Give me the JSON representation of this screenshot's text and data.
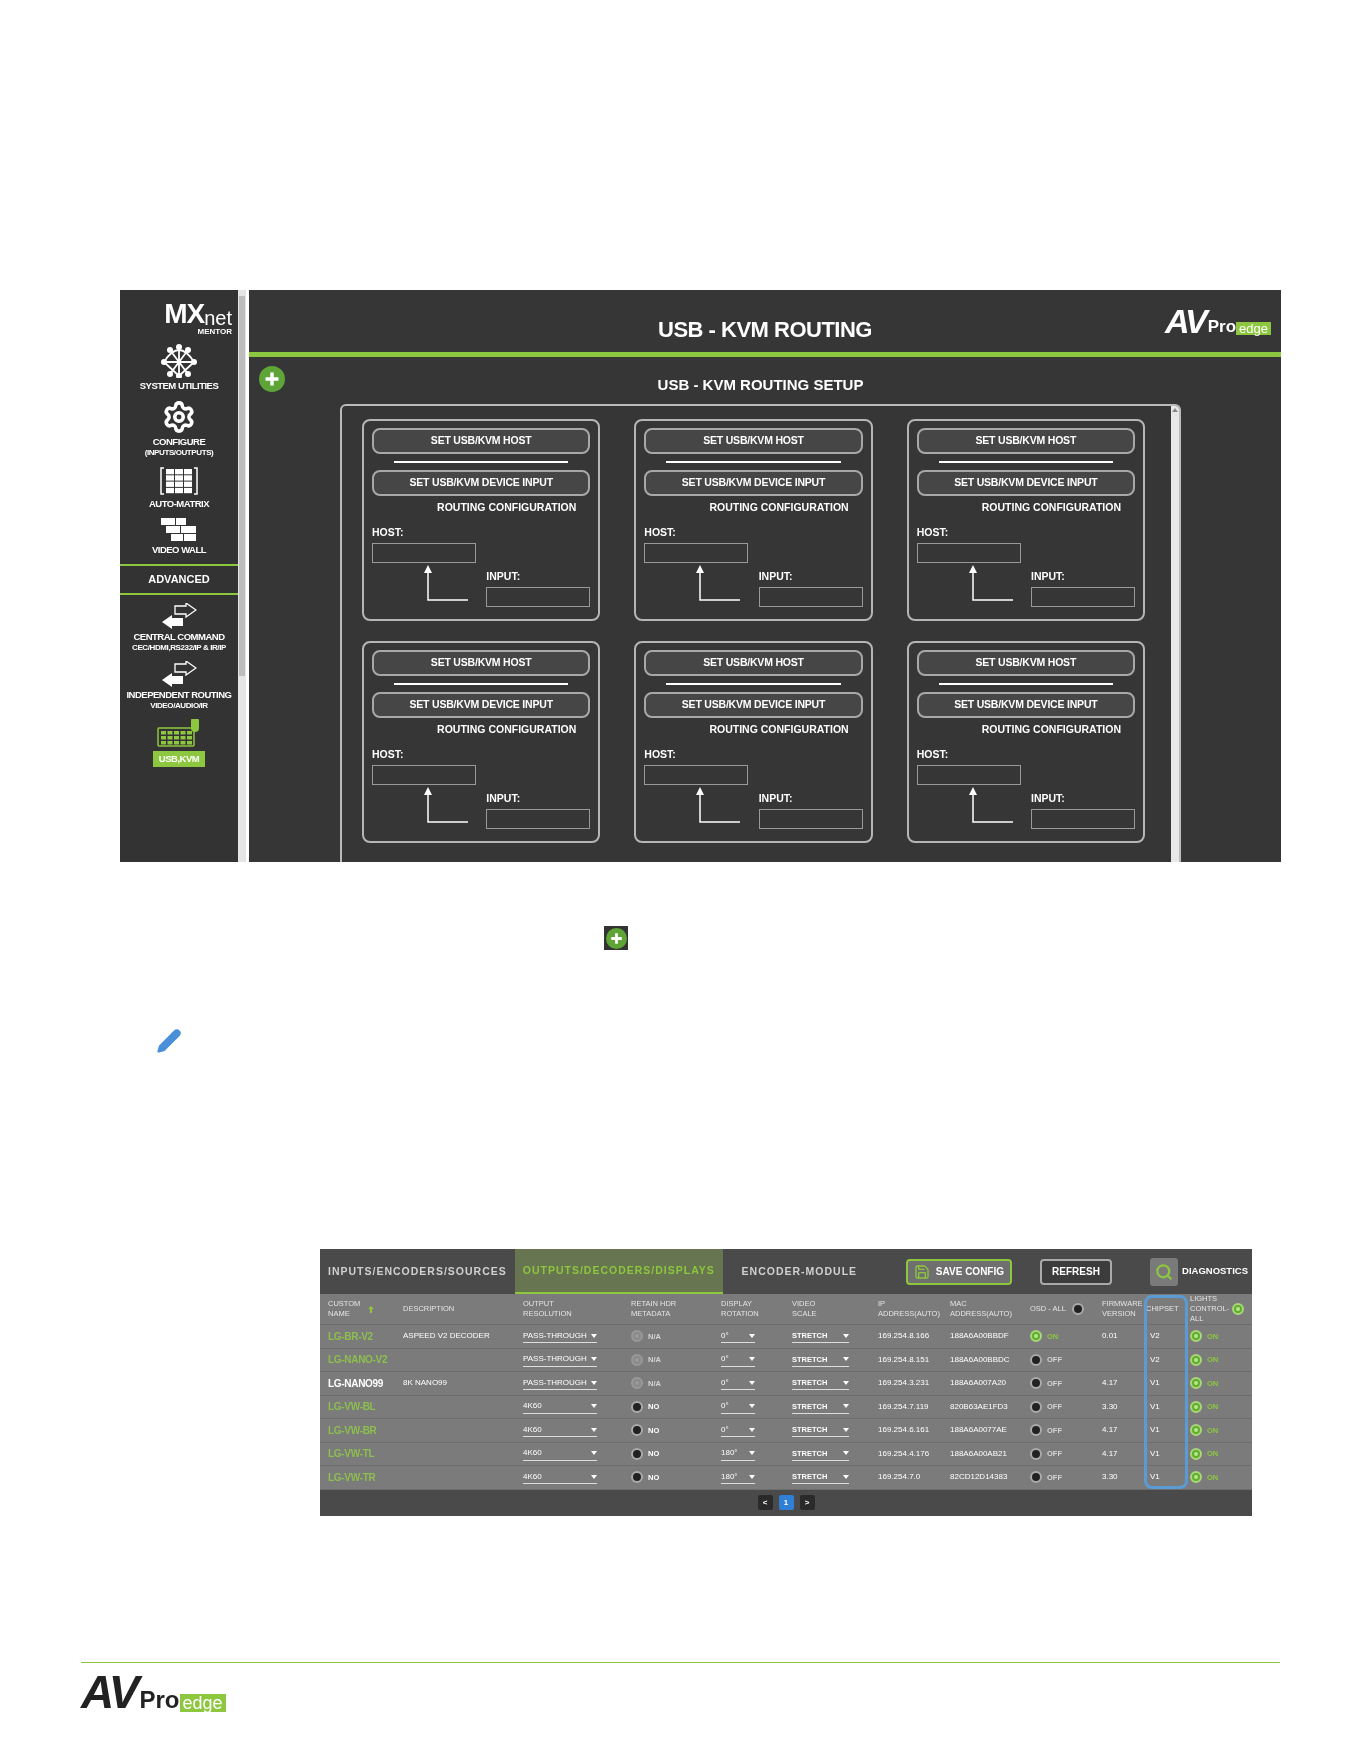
{
  "kvm_screen": {
    "sidebar": {
      "logo": {
        "main": "MX",
        "suffix": "net",
        "tagline": "MENTOR"
      },
      "items": [
        {
          "label": "SYSTEM UTILITIES",
          "selected": false
        },
        {
          "label": "CONFIGURE",
          "sublabel": "(INPUTS/OUTPUTS)",
          "selected": false
        },
        {
          "label": "AUTO-MATRIX",
          "selected": false
        },
        {
          "label": "VIDEO WALL",
          "selected": false
        }
      ],
      "section": "ADVANCED",
      "advanced_items": [
        {
          "label": "CENTRAL COMMAND",
          "sublabel": "CEC/HDMI,RS232/IP & IR/IP",
          "selected": false
        },
        {
          "label": "INDEPENDENT ROUTING",
          "sublabel": "VIDEO/AUDIO/IR",
          "selected": false
        },
        {
          "label": "USB,KVM",
          "selected": true
        }
      ]
    },
    "header": {
      "title": "USB - KVM ROUTING",
      "logo": {
        "mark": "AV",
        "word": "Pro",
        "tag": "edge"
      }
    },
    "setup": {
      "title": "USB - KVM ROUTING SETUP",
      "cards": [
        {
          "host_button": "SET USB/KVM HOST",
          "input_button": "SET USB/KVM DEVICE INPUT",
          "caption": "ROUTING CONFIGURATION",
          "host_label": "HOST:",
          "input_label": "INPUT:"
        },
        {
          "host_button": "SET USB/KVM HOST",
          "input_button": "SET USB/KVM DEVICE INPUT",
          "caption": "ROUTING CONFIGURATION",
          "host_label": "HOST:",
          "input_label": "INPUT:"
        },
        {
          "host_button": "SET USB/KVM HOST",
          "input_button": "SET USB/KVM DEVICE INPUT",
          "caption": "ROUTING CONFIGURATION",
          "host_label": "HOST:",
          "input_label": "INPUT:"
        },
        {
          "host_button": "SET USB/KVM HOST",
          "input_button": "SET USB/KVM DEVICE INPUT",
          "caption": "ROUTING CONFIGURATION",
          "host_label": "HOST:",
          "input_label": "INPUT:"
        },
        {
          "host_button": "SET USB/KVM HOST",
          "input_button": "SET USB/KVM DEVICE INPUT",
          "caption": "ROUTING CONFIGURATION",
          "host_label": "HOST:",
          "input_label": "INPUT:"
        },
        {
          "host_button": "SET USB/KVM HOST",
          "input_button": "SET USB/KVM DEVICE INPUT",
          "caption": "ROUTING CONFIGURATION",
          "host_label": "HOST:",
          "input_label": "INPUT:"
        }
      ]
    }
  },
  "devices_screen": {
    "tabs": [
      {
        "label": "INPUTS/ENCODERS/SOURCES",
        "selected": false
      },
      {
        "label": "OUTPUTS/DECODERS/DISPLAYS",
        "selected": true
      },
      {
        "label": "ENCODER-MODULE",
        "selected": false
      }
    ],
    "buttons": [
      {
        "kind": "save",
        "label": "SAVE CONFIG"
      },
      {
        "kind": "refresh",
        "label": "REFRESH"
      },
      {
        "kind": "diagnostics",
        "label": "DIAGNOSTICS"
      }
    ],
    "columns": [
      {
        "label": "CUSTOM NAME",
        "sorted": true
      },
      {
        "label": "DESCRIPTION"
      },
      {
        "label": "OUTPUT RESOLUTION"
      },
      {
        "label": "RETAIN HDR METADATA"
      },
      {
        "label": "DISPLAY ROTATION"
      },
      {
        "label": "VIDEO SCALE"
      },
      {
        "label": "IP ADDRESS(AUTO)"
      },
      {
        "label": "MAC ADDRESS(AUTO)"
      },
      {
        "label": "OSD - ALL",
        "toggle_on": false
      },
      {
        "label": "FIRMWARE VERSION"
      },
      {
        "label": "CHIPSET",
        "highlighted": true
      },
      {
        "label": "LIGHTS CONTROL-ALL",
        "toggle_on": true
      }
    ],
    "rows": [
      {
        "name": "LG-BR-V2",
        "color": "#8dbf4e",
        "description": "ASPEED V2 DECODER",
        "resolution": "PASS-THROUGH",
        "hdr": {
          "label": "N/A",
          "disabled": true
        },
        "rotation": "0°",
        "scale": "STRETCH",
        "ip": "169.254.8.166",
        "mac": "188A6A00BBDF",
        "osd": {
          "label": "ON",
          "on": true
        },
        "firmware": "0.01",
        "chipset": "V2",
        "lights": {
          "label": "ON",
          "on": true
        }
      },
      {
        "name": "LG-NANO-V2",
        "color": "#8dbf4e",
        "resolution": "PASS-THROUGH",
        "hdr": {
          "label": "N/A",
          "disabled": true
        },
        "rotation": "0°",
        "scale": "STRETCH",
        "ip": "169.254.8.151",
        "mac": "188A6A00BBDC",
        "osd": {
          "label": "OFF",
          "on": false
        },
        "chipset": "V2",
        "lights": {
          "label": "ON",
          "on": true
        }
      },
      {
        "name": "LG-NANO99",
        "color": "#ffffff",
        "description": "8K NANO99",
        "resolution": "PASS-THROUGH",
        "hdr": {
          "label": "N/A",
          "disabled": true
        },
        "rotation": "0°",
        "scale": "STRETCH",
        "ip": "169.254.3.231",
        "mac": "188A6A007A20",
        "osd": {
          "label": "OFF",
          "on": false
        },
        "firmware": "4.17",
        "chipset": "V1",
        "lights": {
          "label": "ON",
          "on": true
        }
      },
      {
        "name": "LG-VW-BL",
        "color": "#8dbf4e",
        "resolution": "4K60",
        "hdr": {
          "label": "NO",
          "disabled": false
        },
        "rotation": "0°",
        "scale": "STRETCH",
        "ip": "169.254.7.119",
        "mac": "820B63AE1FD3",
        "osd": {
          "label": "OFF",
          "on": false
        },
        "firmware": "3.30",
        "chipset": "V1",
        "lights": {
          "label": "ON",
          "on": true
        }
      },
      {
        "name": "LG-VW-BR",
        "color": "#8dbf4e",
        "resolution": "4K60",
        "hdr": {
          "label": "NO",
          "disabled": false
        },
        "rotation": "0°",
        "scale": "STRETCH",
        "ip": "169.254.6.161",
        "mac": "188A6A0077AE",
        "osd": {
          "label": "OFF",
          "on": false
        },
        "firmware": "4.17",
        "chipset": "V1",
        "lights": {
          "label": "ON",
          "on": true
        }
      },
      {
        "name": "LG-VW-TL",
        "color": "#8dbf4e",
        "resolution": "4K60",
        "hdr": {
          "label": "NO",
          "disabled": false
        },
        "rotation": "180°",
        "scale": "STRETCH",
        "ip": "169.254.4.176",
        "mac": "188A6A00AB21",
        "osd": {
          "label": "OFF",
          "on": false
        },
        "firmware": "4.17",
        "chipset": "V1",
        "lights": {
          "label": "ON",
          "on": true
        }
      },
      {
        "name": "LG-VW-TR",
        "color": "#8dbf4e",
        "resolution": "4K60",
        "hdr": {
          "label": "NO",
          "disabled": false
        },
        "rotation": "180°",
        "scale": "STRETCH",
        "ip": "169.254.7.0",
        "mac": "82CD12D14383",
        "osd": {
          "label": "OFF",
          "on": false
        },
        "firmware": "3.30",
        "chipset": "V1",
        "lights": {
          "label": "ON",
          "on": true
        }
      }
    ],
    "pagination": [
      {
        "label": "<",
        "selected": false
      },
      {
        "label": "1",
        "selected": true
      },
      {
        "label": ">",
        "selected": false
      }
    ]
  },
  "footer": {
    "logo": {
      "mark": "AV",
      "word": "Pro",
      "tag": "edge"
    }
  }
}
